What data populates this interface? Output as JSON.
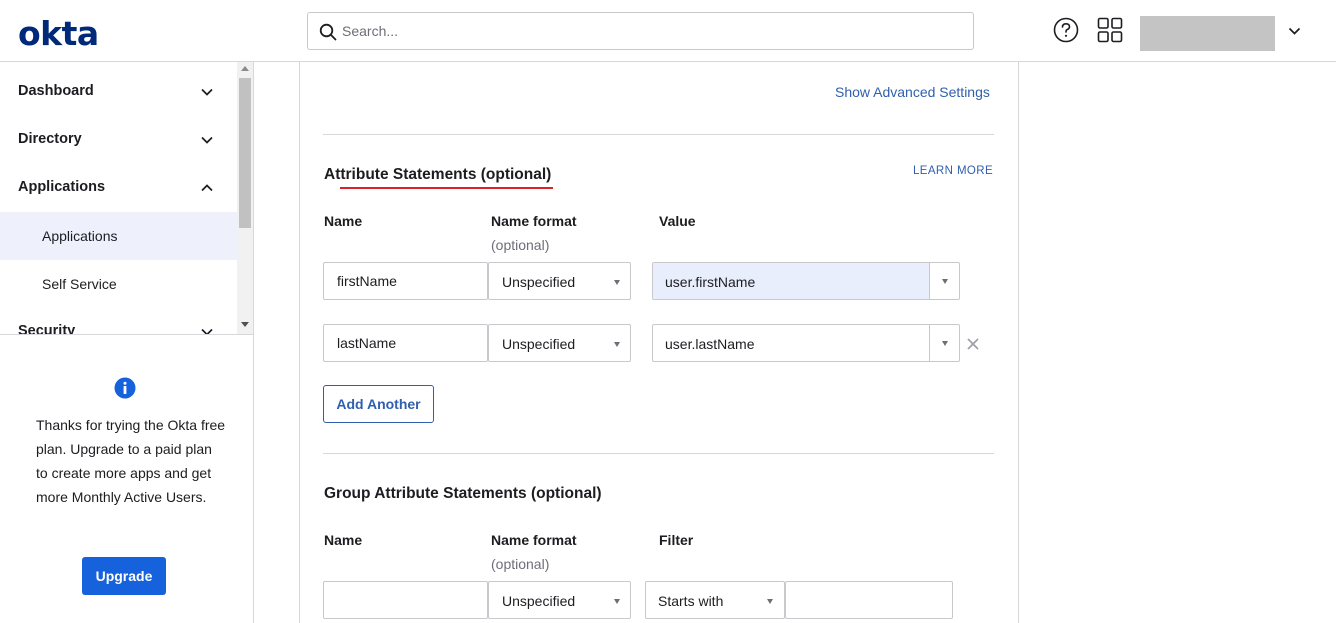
{
  "header": {
    "logo": "okta",
    "search_placeholder": "Search...",
    "icons": [
      "search-icon",
      "help-icon",
      "apps-grid-icon",
      "chevron-down-icon"
    ]
  },
  "sidebar": {
    "items": [
      {
        "label": "Dashboard",
        "expanded": false
      },
      {
        "label": "Directory",
        "expanded": false
      },
      {
        "label": "Applications",
        "expanded": true
      },
      {
        "label": "Security",
        "expanded": false
      }
    ],
    "sub_items": [
      {
        "label": "Applications",
        "active": true
      },
      {
        "label": "Self Service",
        "active": false
      }
    ],
    "promo_text": "Thanks for trying the Okta free plan. Upgrade to a paid plan to create more apps and get more Monthly Active Users.",
    "upgrade_label": "Upgrade"
  },
  "main": {
    "advanced_link": "Show Advanced Settings",
    "attribute_section": {
      "title": "Attribute Statements (optional)",
      "learn_more": "LEARN MORE",
      "col_name": "Name",
      "col_format": "Name format",
      "col_format_sub": "(optional)",
      "col_value": "Value",
      "rows": [
        {
          "name": "firstName",
          "format": "Unspecified",
          "value": "user.firstName"
        },
        {
          "name": "lastName",
          "format": "Unspecified",
          "value": "user.lastName"
        }
      ],
      "add_label": "Add Another"
    },
    "group_section": {
      "title": "Group Attribute Statements (optional)",
      "col_name": "Name",
      "col_format": "Name format",
      "col_format_sub": "(optional)",
      "col_filter": "Filter",
      "row": {
        "name": "",
        "format": "Unspecified",
        "filter_type": "Starts with",
        "filter_value": ""
      }
    }
  },
  "colors": {
    "brand": "#00297a",
    "link": "#2f5fad",
    "primary_button": "#1662dd",
    "accent_underline": "#d9222a",
    "active_nav_bg": "#eef0fc"
  }
}
